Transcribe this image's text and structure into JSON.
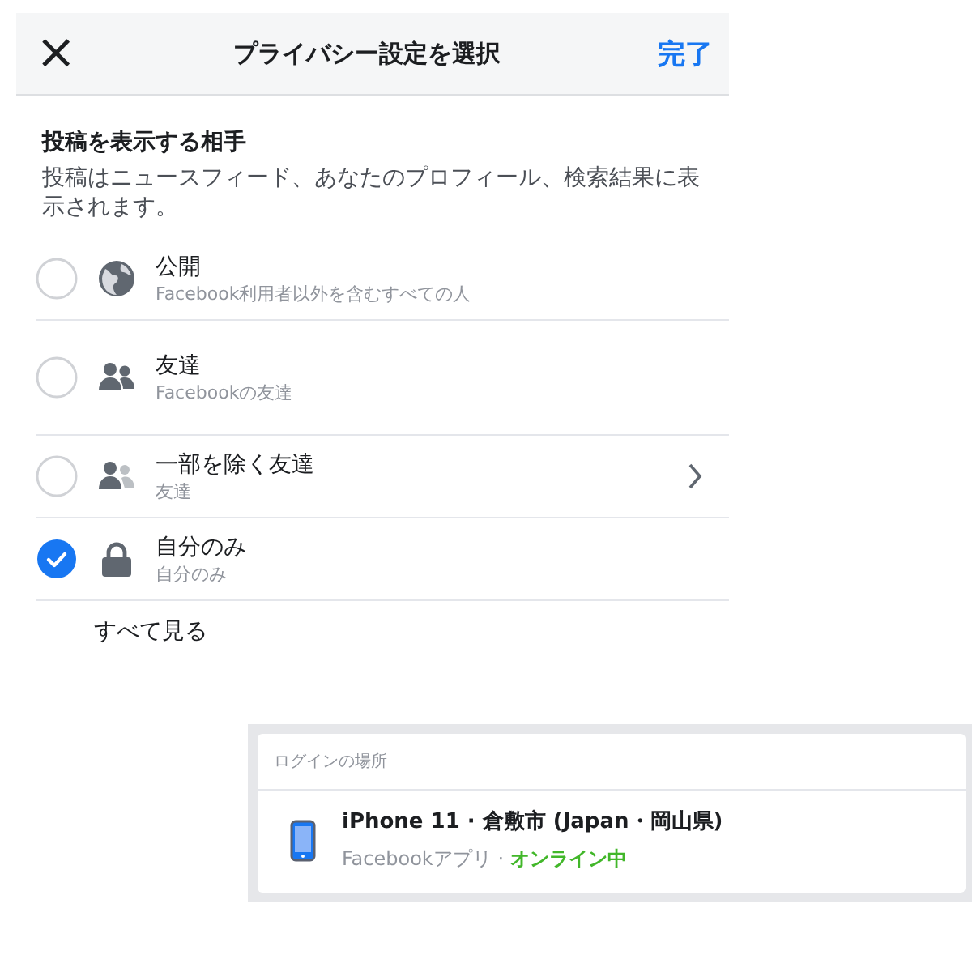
{
  "header": {
    "close": "×",
    "title": "プライバシー設定を選択",
    "done": "完了"
  },
  "section": {
    "title": "投稿を表示する相手",
    "description": "投稿はニュースフィード、あなたのプロフィール、検索結果に表示されます。"
  },
  "options": [
    {
      "kind": "globe",
      "label": "公開",
      "sublabel": "Facebook利用者以外を含むすべての人",
      "selected": false,
      "chevron": false
    },
    {
      "kind": "friends",
      "label": "友達",
      "sublabel": "Facebookの友達",
      "selected": false,
      "chevron": false
    },
    {
      "kind": "friends-except",
      "label": "一部を除く友達",
      "sublabel": "友達",
      "selected": false,
      "chevron": true
    },
    {
      "kind": "lock",
      "label": "自分のみ",
      "sublabel": "自分のみ",
      "selected": true,
      "chevron": false
    }
  ],
  "see_all": "すべて見る",
  "login_card": {
    "heading": "ログインの場所",
    "device": "iPhone 11 · 倉敷市 (Japan・岡山県)",
    "app": "Facebookアプリ · ",
    "status": "オンライン中"
  }
}
